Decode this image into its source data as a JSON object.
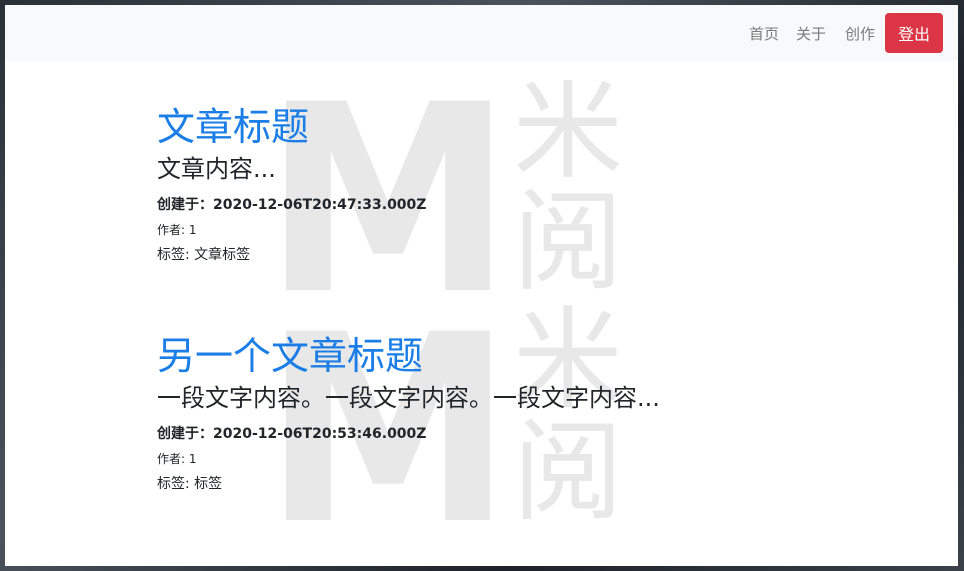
{
  "navbar": {
    "links": [
      "首页",
      "关于",
      "创作"
    ],
    "logout_label": "登出"
  },
  "watermark": {
    "letter": "M",
    "chars": [
      "米",
      "阅"
    ]
  },
  "posts": [
    {
      "title": "文章标题",
      "body": "文章内容...",
      "created": "创建于：2020-12-06T20:47:33.000Z",
      "author": "作者: 1",
      "tags": "标签: 文章标签"
    },
    {
      "title": "另一个文章标题",
      "body": "一段文字内容。一段文字内容。一段文字内容...",
      "created": "创建于：2020-12-06T20:53:46.000Z",
      "author": "作者: 1",
      "tags": "标签: 标签"
    }
  ],
  "colors": {
    "link_blue": "#1a7ee6",
    "logout_red": "#dc3545",
    "navbar_bg": "#f8f9fa",
    "watermark_gray": "#e6e6e6"
  }
}
